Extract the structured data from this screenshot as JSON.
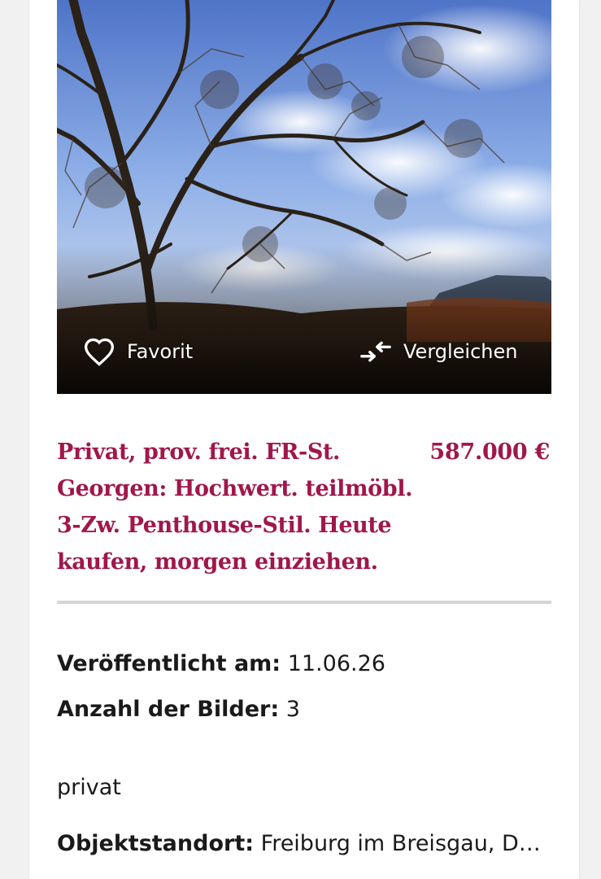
{
  "listing": {
    "photo": {
      "favorite_label": "Favorit",
      "compare_label": "Vergleichen",
      "favorite_icon": "heart-outline-icon",
      "compare_icon": "compare-arrows-icon"
    },
    "title": "Privat, prov. frei. FR-St. Georgen: Hochwert. teilmöbl. 3-Zw. Penthouse-Stil. Heute kaufen, morgen einziehen.",
    "price": "587.000 €",
    "published_label": "Veröffentlicht am:",
    "published_value": "11.06.26",
    "images_label": "Anzahl der Bilder:",
    "images_value": "3",
    "seller_type": "privat",
    "location_label": "Objektstandort:",
    "location_value": "Freiburg im Breisgau, Deut…"
  },
  "colors": {
    "accent": "#a0174b",
    "text": "#1a1a1a",
    "divider": "#d5d5d5",
    "background": "#f1f1f1"
  }
}
